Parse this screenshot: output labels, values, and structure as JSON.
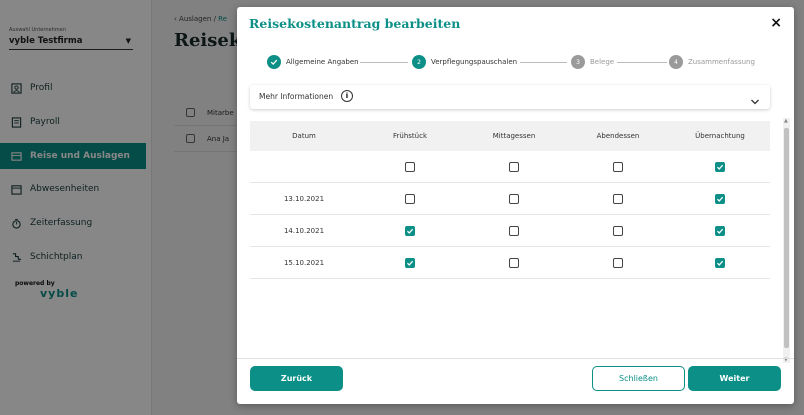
{
  "sidebar": {
    "company_label": "Auswahl Unternehmen",
    "company_value": "vyble Testfirma",
    "items": [
      {
        "label": "Profil",
        "icon": "person-icon"
      },
      {
        "label": "Payroll",
        "icon": "document-icon"
      },
      {
        "label": "Reise und Auslagen",
        "icon": "wallet-icon",
        "active": true
      },
      {
        "label": "Abwesenheiten",
        "icon": "calendar-icon"
      },
      {
        "label": "Zeiterfassung",
        "icon": "stopwatch-icon"
      },
      {
        "label": "Schichtplan",
        "icon": "shift-icon"
      }
    ],
    "powered_by": "powered by",
    "brand": "vyble"
  },
  "background": {
    "breadcrumb_root": "Auslagen",
    "breadcrumb_sep": "/",
    "breadcrumb_current": "Re",
    "title": "Reiseko",
    "table_header": "Mitarbe",
    "table_row": "Ana Ja"
  },
  "modal": {
    "title": "Reisekostenantrag bearbeiten",
    "close": "×",
    "steps": [
      {
        "num": "",
        "label": "Allgemeine Angaben",
        "state": "done"
      },
      {
        "num": "2",
        "label": "Verpflegungspauschalen",
        "state": "current"
      },
      {
        "num": "3",
        "label": "Belege",
        "state": "todo"
      },
      {
        "num": "4",
        "label": "Zusammenfassung",
        "state": "todo"
      }
    ],
    "info": {
      "label": "Mehr Informationen",
      "icon_text": "i"
    },
    "table": {
      "headers": [
        "Datum",
        "Frühstück",
        "Mittagessen",
        "Abendessen",
        "Übernachtung"
      ],
      "rows": [
        {
          "date": "",
          "checks": [
            false,
            false,
            false,
            true
          ]
        },
        {
          "date": "13.10.2021",
          "checks": [
            false,
            false,
            false,
            true
          ]
        },
        {
          "date": "14.10.2021",
          "checks": [
            true,
            false,
            false,
            true
          ]
        },
        {
          "date": "15.10.2021",
          "checks": [
            true,
            false,
            false,
            true
          ]
        }
      ]
    },
    "buttons": {
      "back": "Zurück",
      "close": "Schließen",
      "next": "Weiter"
    }
  },
  "colors": {
    "accent": "#0b8f86"
  }
}
